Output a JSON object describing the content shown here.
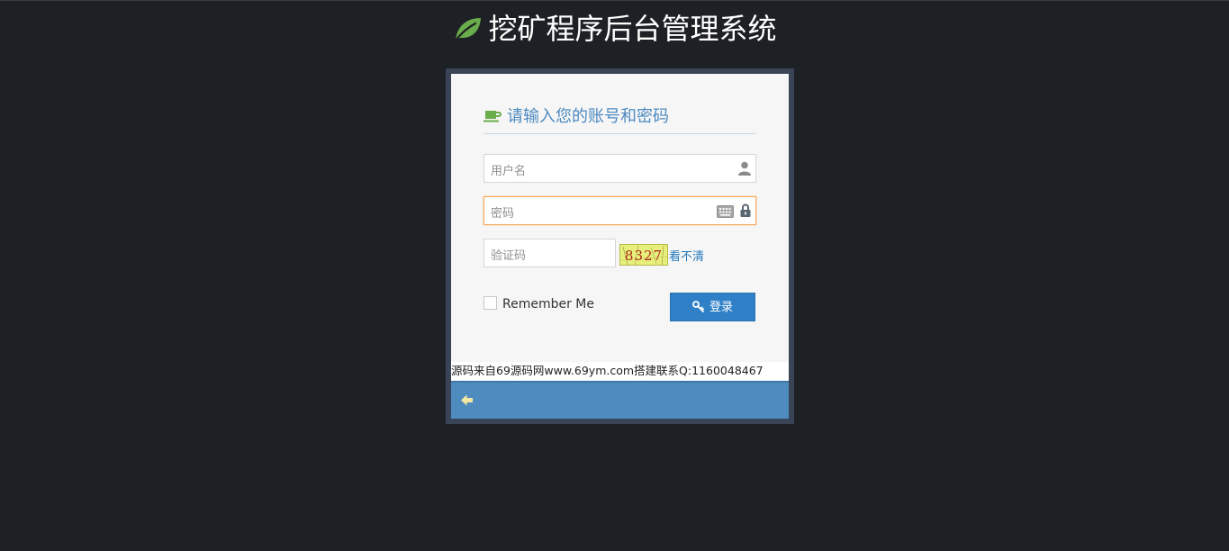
{
  "header": {
    "title": "挖矿程序后台管理系统",
    "icon": "leaf-icon"
  },
  "login_box": {
    "title": "请输入您的账号和密码",
    "title_icon": "coffee-icon",
    "username": {
      "value": "",
      "placeholder": "用户名",
      "icon": "user-icon"
    },
    "password": {
      "value": "",
      "placeholder": "密码",
      "icons": [
        "keyboard-icon",
        "lock-icon"
      ]
    },
    "captcha": {
      "value": "",
      "placeholder": "验证码",
      "image_text": "8327",
      "refresh_label": "看不清"
    },
    "remember_label": "Remember Me",
    "login_label": "登录",
    "login_icon": "key-icon",
    "watermark": "源码来自69源码网www.69ym.com搭建联系Q:1160048467",
    "toolbar": {
      "back_icon": "arrow-left-icon"
    }
  },
  "colors": {
    "background": "#1d2024",
    "box_frame": "#394557",
    "box": "#f6f6f6",
    "title": "#4d8ac0",
    "button": "#3080c8",
    "toolbar": "#4e8cc0",
    "leaf": "#6aad4c",
    "focus": "#f5a85a"
  }
}
